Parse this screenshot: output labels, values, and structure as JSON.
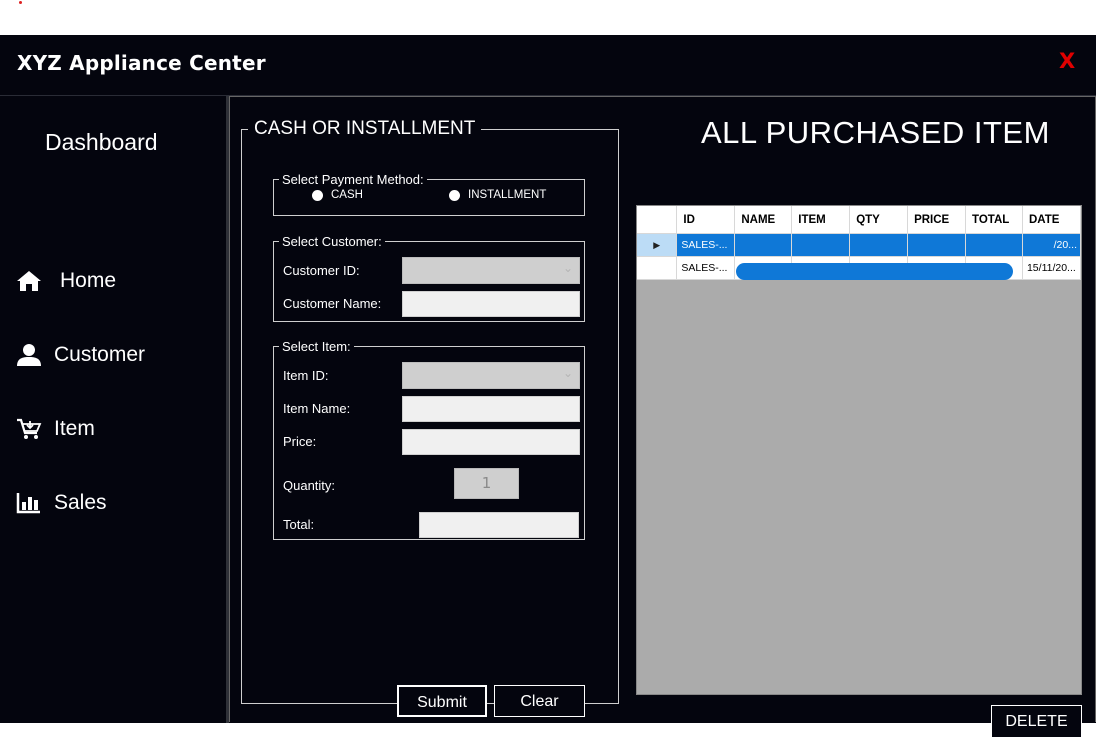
{
  "window": {
    "title": "XYZ Appliance Center",
    "close_label": "X"
  },
  "sidebar": {
    "title": "Dashboard",
    "items": [
      {
        "label": "Home",
        "icon": "home-icon"
      },
      {
        "label": "Customer",
        "icon": "user-icon"
      },
      {
        "label": "Item",
        "icon": "cart-icon"
      },
      {
        "label": "Sales",
        "icon": "bar-chart-icon"
      }
    ]
  },
  "form": {
    "legend": "CASH OR INSTALLMENT",
    "payment": {
      "legend": "Select Payment Method:",
      "options": [
        "CASH",
        "INSTALLMENT"
      ]
    },
    "customer": {
      "legend": "Select Customer:",
      "id_label": "Customer ID:",
      "id_value": "",
      "name_label": "Customer Name:",
      "name_value": ""
    },
    "item": {
      "legend": "Select Item:",
      "id_label": "Item ID:",
      "id_value": "",
      "name_label": "Item Name:",
      "name_value": "",
      "price_label": "Price:",
      "price_value": "",
      "quantity_label": "Quantity:",
      "quantity_value": "1",
      "total_label": "Total:",
      "total_value": ""
    },
    "submit_label": "Submit",
    "clear_label": "Clear"
  },
  "grid": {
    "title": "ALL PURCHASED ITEM",
    "columns": [
      "ID",
      "NAME",
      "ITEM",
      "QTY",
      "PRICE",
      "TOTAL",
      "DATE"
    ],
    "rows": [
      [
        "SALES-...",
        "",
        "",
        "",
        "",
        "",
        "/20..."
      ],
      [
        "SALES-...",
        "",
        "",
        "",
        "",
        "",
        "15/11/20..."
      ]
    ],
    "selected_row": 0,
    "delete_label": "DELETE"
  },
  "colors": {
    "background": "#04050e",
    "close": "#e00000",
    "selection": "#0f78d7",
    "grid_empty": "#ababab"
  }
}
